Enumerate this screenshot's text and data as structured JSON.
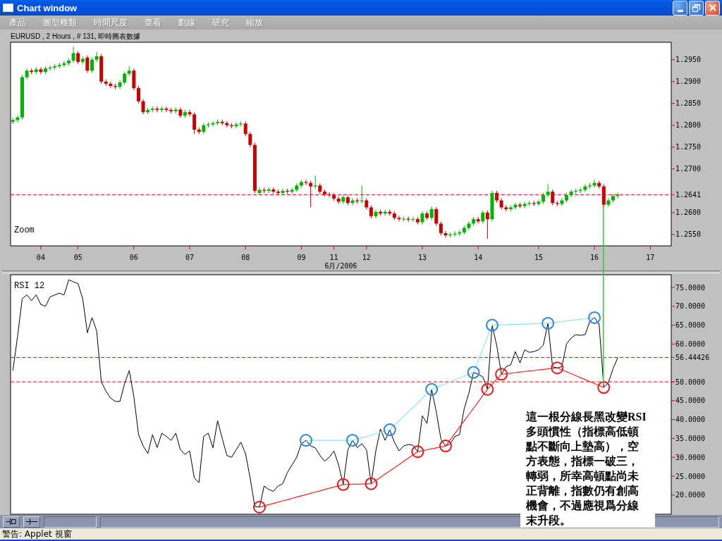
{
  "window": {
    "title": "Chart window"
  },
  "menu": [
    "產品",
    "圖型種類",
    "時間尺度",
    "查看",
    "劃線",
    "研究",
    "縮放"
  ],
  "price_panel": {
    "corner_label": "Zoom",
    "chart_data": {
      "type": "candlestick",
      "title": "EURUSD , 2 Hours , # 131, 即時圖表數據",
      "xlabel": "6月/2006",
      "ylim": [
        1.2524,
        1.299
      ],
      "categories": [
        null,
        null,
        null,
        null,
        null,
        null,
        "04",
        null,
        null,
        null,
        null,
        null,
        null,
        null,
        "05",
        null,
        null,
        null,
        null,
        null,
        null,
        null,
        null,
        null,
        null,
        null,
        "06",
        null,
        null,
        null,
        null,
        null,
        null,
        null,
        null,
        null,
        null,
        null,
        "07",
        null,
        null,
        null,
        null,
        null,
        null,
        null,
        null,
        null,
        null,
        null,
        "08",
        null,
        null,
        null,
        null,
        null,
        null,
        null,
        null,
        null,
        null,
        null,
        "09",
        null,
        null,
        null,
        null,
        null,
        null,
        "11",
        null,
        null,
        null,
        null,
        null,
        null,
        "12",
        null,
        null,
        null,
        null,
        null,
        null,
        null,
        null,
        null,
        null,
        null,
        "13",
        null,
        null,
        null,
        null,
        null,
        null,
        null,
        null,
        null,
        null,
        null,
        "14",
        null,
        null,
        null,
        null,
        null,
        null,
        null,
        null,
        null,
        null,
        null,
        null,
        "15",
        null,
        null,
        null,
        null,
        null,
        null,
        null,
        null,
        null,
        null,
        null,
        "16",
        null,
        null,
        null,
        null,
        null,
        null,
        null,
        null,
        null,
        null,
        null,
        "17",
        null,
        null,
        null,
        null
      ],
      "yticks": [
        {
          "value": 1.255,
          "label": "1.2550"
        },
        {
          "value": 1.26,
          "label": "1.2600"
        },
        {
          "value": 1.27,
          "label": "1.2700"
        },
        {
          "value": 1.275,
          "label": "1.2750"
        },
        {
          "value": 1.28,
          "label": "1.2800"
        },
        {
          "value": 1.285,
          "label": "1.2850"
        },
        {
          "value": 1.29,
          "label": "1.2900"
        },
        {
          "value": 1.295,
          "label": "1.2950"
        }
      ],
      "ref_lines": [
        {
          "axis": "y",
          "value": 1.2641,
          "label": "1.2641"
        }
      ],
      "ohlc": [
        [
          1.2808,
          1.2817,
          1.2803,
          1.2812
        ],
        [
          1.2812,
          1.2823,
          1.2807,
          1.2818
        ],
        [
          1.2818,
          1.2915,
          1.2813,
          1.291
        ],
        [
          1.291,
          1.293,
          1.2905,
          1.2925
        ],
        [
          1.2925,
          1.293,
          1.2917,
          1.2922
        ],
        [
          1.2922,
          1.2933,
          1.2917,
          1.2928
        ],
        [
          1.2928,
          1.2933,
          1.2917,
          1.2922
        ],
        [
          1.2922,
          1.2935,
          1.2917,
          1.293
        ],
        [
          1.293,
          1.2937,
          1.2925,
          1.2932
        ],
        [
          1.2932,
          1.294,
          1.2927,
          1.2935
        ],
        [
          1.2935,
          1.2943,
          1.293,
          1.2938
        ],
        [
          1.2938,
          1.2947,
          1.2933,
          1.2942
        ],
        [
          1.2942,
          1.2953,
          1.2937,
          1.2948
        ],
        [
          1.2948,
          1.298,
          1.2943,
          1.2965
        ],
        [
          1.2965,
          1.297,
          1.294,
          1.2945
        ],
        [
          1.2945,
          1.2957,
          1.294,
          1.2952
        ],
        [
          1.2955,
          1.296,
          1.292,
          1.2925
        ],
        [
          1.2925,
          1.2955,
          1.292,
          1.295
        ],
        [
          1.295,
          1.2968,
          1.2945,
          1.2958
        ],
        [
          1.2958,
          1.2963,
          1.2895,
          1.29
        ],
        [
          1.29,
          1.2905,
          1.289,
          1.2895
        ],
        [
          1.2895,
          1.29,
          1.2885,
          1.289
        ],
        [
          1.289,
          1.2895,
          1.2883,
          1.2888
        ],
        [
          1.2888,
          1.2903,
          1.2883,
          1.2898
        ],
        [
          1.2898,
          1.2923,
          1.2893,
          1.2918
        ],
        [
          1.2918,
          1.2935,
          1.2913,
          1.2925
        ],
        [
          1.2925,
          1.293,
          1.288,
          1.2885
        ],
        [
          1.2885,
          1.289,
          1.285,
          1.2855
        ],
        [
          1.2855,
          1.286,
          1.2825,
          1.283
        ],
        [
          1.283,
          1.284,
          1.2825,
          1.2835
        ],
        [
          1.2835,
          1.2843,
          1.283,
          1.2838
        ],
        [
          1.2838,
          1.2843,
          1.283,
          1.2835
        ],
        [
          1.2835,
          1.2843,
          1.283,
          1.2838
        ],
        [
          1.2838,
          1.2843,
          1.283,
          1.2835
        ],
        [
          1.2835,
          1.284,
          1.2827,
          1.2832
        ],
        [
          1.2832,
          1.2841,
          1.2827,
          1.2836
        ],
        [
          1.2836,
          1.2841,
          1.2817,
          1.2822
        ],
        [
          1.2822,
          1.2835,
          1.2817,
          1.283
        ],
        [
          1.283,
          1.2835,
          1.282,
          1.2825
        ],
        [
          1.2825,
          1.283,
          1.278,
          1.279
        ],
        [
          1.279,
          1.2795,
          1.278,
          1.2785
        ],
        [
          1.2785,
          1.2805,
          1.278,
          1.28
        ],
        [
          1.28,
          1.2807,
          1.2795,
          1.2802
        ],
        [
          1.2802,
          1.281,
          1.2797,
          1.2805
        ],
        [
          1.2805,
          1.2813,
          1.28,
          1.2808
        ],
        [
          1.2808,
          1.2813,
          1.28,
          1.2805
        ],
        [
          1.2805,
          1.281,
          1.2795,
          1.28
        ],
        [
          1.28,
          1.2805,
          1.2793,
          1.2798
        ],
        [
          1.2798,
          1.2807,
          1.2793,
          1.2802
        ],
        [
          1.2802,
          1.2809,
          1.2797,
          1.2804
        ],
        [
          1.2804,
          1.2809,
          1.2775,
          1.278
        ],
        [
          1.278,
          1.2785,
          1.275,
          1.2755
        ],
        [
          1.2755,
          1.276,
          1.2645,
          1.265
        ],
        [
          1.2645,
          1.2657,
          1.264,
          1.2652
        ],
        [
          1.2652,
          1.2657,
          1.2645,
          1.265
        ],
        [
          1.265,
          1.2658,
          1.2645,
          1.2653
        ],
        [
          1.2653,
          1.2658,
          1.2643,
          1.2648
        ],
        [
          1.2648,
          1.2653,
          1.264,
          1.2645
        ],
        [
          1.2645,
          1.2655,
          1.264,
          1.265
        ],
        [
          1.265,
          1.2655,
          1.2643,
          1.2648
        ],
        [
          1.2648,
          1.2657,
          1.2643,
          1.2652
        ],
        [
          1.2652,
          1.2667,
          1.2647,
          1.2662
        ],
        [
          1.2662,
          1.2675,
          1.2657,
          1.267
        ],
        [
          1.267,
          1.2675,
          1.2663,
          1.2668
        ],
        [
          1.2668,
          1.2673,
          1.2612,
          1.266
        ],
        [
          1.266,
          1.2685,
          1.2655,
          1.2662
        ],
        [
          1.2662,
          1.2667,
          1.2643,
          1.2648
        ],
        [
          1.2648,
          1.2653,
          1.2637,
          1.2642
        ],
        [
          1.2642,
          1.2647,
          1.2635,
          1.264
        ],
        [
          1.264,
          1.2645,
          1.2627,
          1.2632
        ],
        [
          1.2632,
          1.2637,
          1.262,
          1.2625
        ],
        [
          1.2625,
          1.264,
          1.262,
          1.2635
        ],
        [
          1.2635,
          1.264,
          1.2617,
          1.2622
        ],
        [
          1.2622,
          1.2633,
          1.2617,
          1.2628
        ],
        [
          1.2628,
          1.2633,
          1.2621,
          1.2626
        ],
        [
          1.2626,
          1.2662,
          1.2621,
          1.2628
        ],
        [
          1.2628,
          1.2633,
          1.2607,
          1.2612
        ],
        [
          1.2612,
          1.2617,
          1.2587,
          1.2592
        ],
        [
          1.2592,
          1.2607,
          1.2587,
          1.2602
        ],
        [
          1.2602,
          1.2607,
          1.2593,
          1.2598
        ],
        [
          1.2598,
          1.2607,
          1.2593,
          1.2602
        ],
        [
          1.2602,
          1.2607,
          1.2593,
          1.2598
        ],
        [
          1.2598,
          1.2603,
          1.2583,
          1.2588
        ],
        [
          1.2588,
          1.2593,
          1.258,
          1.2585
        ],
        [
          1.2585,
          1.2591,
          1.258,
          1.2586
        ],
        [
          1.2586,
          1.2591,
          1.2579,
          1.2584
        ],
        [
          1.2584,
          1.259,
          1.2579,
          1.2585
        ],
        [
          1.2585,
          1.259,
          1.2573,
          1.2578
        ],
        [
          1.2578,
          1.2603,
          1.2573,
          1.2598
        ],
        [
          1.2598,
          1.2603,
          1.2583,
          1.2588
        ],
        [
          1.2588,
          1.2614,
          1.2583,
          1.2608
        ],
        [
          1.2608,
          1.2613,
          1.257,
          1.2575
        ],
        [
          1.2575,
          1.258,
          1.2548,
          1.2553
        ],
        [
          1.2553,
          1.2558,
          1.2543,
          1.2548
        ],
        [
          1.2548,
          1.2555,
          1.2543,
          1.255
        ],
        [
          1.255,
          1.2557,
          1.2545,
          1.2552
        ],
        [
          1.2552,
          1.256,
          1.2547,
          1.2555
        ],
        [
          1.2555,
          1.257,
          1.255,
          1.2565
        ],
        [
          1.2565,
          1.258,
          1.256,
          1.2575
        ],
        [
          1.2575,
          1.259,
          1.257,
          1.2585
        ],
        [
          1.2585,
          1.259,
          1.2575,
          1.258
        ],
        [
          1.258,
          1.2605,
          1.2575,
          1.26
        ],
        [
          1.26,
          1.2605,
          1.254,
          1.2585
        ],
        [
          1.2585,
          1.265,
          1.258,
          1.2645
        ],
        [
          1.2645,
          1.265,
          1.2623,
          1.2628
        ],
        [
          1.2628,
          1.2633,
          1.2607,
          1.2612
        ],
        [
          1.2612,
          1.2617,
          1.2603,
          1.2608
        ],
        [
          1.2608,
          1.2617,
          1.2603,
          1.2612
        ],
        [
          1.2612,
          1.2623,
          1.2607,
          1.2618
        ],
        [
          1.2618,
          1.2623,
          1.261,
          1.2615
        ],
        [
          1.2615,
          1.2625,
          1.261,
          1.262
        ],
        [
          1.262,
          1.2627,
          1.2615,
          1.2622
        ],
        [
          1.2622,
          1.2627,
          1.2615,
          1.262
        ],
        [
          1.262,
          1.263,
          1.2615,
          1.2625
        ],
        [
          1.2625,
          1.2645,
          1.262,
          1.264
        ],
        [
          1.264,
          1.2665,
          1.2635,
          1.2648
        ],
        [
          1.2648,
          1.2653,
          1.2617,
          1.2622
        ],
        [
          1.2622,
          1.2627,
          1.2615,
          1.262
        ],
        [
          1.262,
          1.2633,
          1.2615,
          1.2628
        ],
        [
          1.2628,
          1.2645,
          1.2623,
          1.264
        ],
        [
          1.264,
          1.2653,
          1.2635,
          1.2648
        ],
        [
          1.2648,
          1.2655,
          1.2643,
          1.265
        ],
        [
          1.265,
          1.2657,
          1.2645,
          1.2652
        ],
        [
          1.2652,
          1.2665,
          1.2647,
          1.266
        ],
        [
          1.266,
          1.2667,
          1.2655,
          1.2662
        ],
        [
          1.2662,
          1.2676,
          1.2657,
          1.2668
        ],
        [
          1.2668,
          1.2673,
          1.2655,
          1.266
        ],
        [
          1.266,
          1.2665,
          1.2613,
          1.2618
        ],
        [
          1.2618,
          1.2633,
          1.2613,
          1.2628
        ],
        [
          1.2628,
          1.2643,
          1.2623,
          1.2638
        ],
        [
          1.2638,
          1.2646,
          1.2633,
          1.2641
        ],
        null,
        null,
        null,
        null,
        null,
        null,
        null,
        null,
        null,
        null,
        null
      ]
    }
  },
  "rsi_panel": {
    "chart_data": {
      "type": "line",
      "title": "RSI 12",
      "ylim": [
        14.93,
        78.36
      ],
      "categories": [
        null,
        null,
        null,
        null,
        null,
        null,
        null,
        null,
        null,
        null,
        null,
        null,
        null,
        null,
        null,
        null,
        null,
        null,
        null,
        null,
        null,
        null,
        null,
        null,
        null,
        null,
        null,
        null,
        null,
        null,
        null,
        null,
        null,
        null,
        null,
        null,
        null,
        null,
        null,
        null,
        null,
        null,
        null,
        null,
        null,
        null,
        null,
        null,
        null,
        null,
        null,
        null,
        null,
        null,
        null,
        null,
        null,
        null,
        null,
        null,
        null,
        null,
        null,
        null,
        null,
        null,
        null,
        null,
        null,
        null,
        null,
        null,
        null,
        null,
        null,
        null,
        null,
        null,
        null,
        null,
        null,
        null,
        null,
        null,
        null,
        null,
        null,
        null,
        null,
        null,
        null,
        null,
        null,
        null,
        null,
        null,
        null,
        null,
        null,
        null,
        null,
        null,
        null,
        null,
        null,
        null,
        null,
        null,
        null,
        null,
        null,
        null,
        null,
        null,
        null,
        null,
        null,
        null,
        null,
        null,
        null,
        null,
        null,
        null,
        null,
        null,
        null,
        null,
        null,
        null,
        null,
        null,
        null,
        null,
        null,
        null,
        null,
        null,
        null,
        null,
        null,
        null
      ],
      "yticks": [
        {
          "value": 20,
          "label": "20.0000"
        },
        {
          "value": 25,
          "label": "25.0000"
        },
        {
          "value": 30,
          "label": "30.0000"
        },
        {
          "value": 35,
          "label": "35.0000"
        },
        {
          "value": 40,
          "label": "40.0000"
        },
        {
          "value": 45,
          "label": "45.0000"
        },
        {
          "value": 50,
          "label": "50.0000"
        },
        {
          "value": 60,
          "label": "60.0000"
        },
        {
          "value": 65,
          "label": "65.0000"
        },
        {
          "value": 70,
          "label": "70.0000"
        },
        {
          "value": 75,
          "label": "75.0000"
        }
      ],
      "ref_lines": [
        {
          "axis": "y",
          "value": 56.44426,
          "label": "56.44426"
        },
        {
          "axis": "y",
          "value": 50
        }
      ],
      "series": [
        {
          "color": "#000000",
          "values": [
            53,
            62,
            72,
            73,
            71.5,
            73,
            70.5,
            70,
            72.5,
            73,
            73.5,
            73,
            77,
            76.5,
            76,
            72,
            63,
            67,
            63.5,
            50,
            47.5,
            45.7,
            44.8,
            44.8,
            49.5,
            53,
            46,
            36,
            33,
            31,
            36,
            32.6,
            36.4,
            35.5,
            34.5,
            36.4,
            32,
            30.8,
            31.7,
            24.5,
            23.3,
            35.5,
            36.4,
            32.5,
            39.7,
            35,
            30.5,
            30,
            32,
            34,
            31,
            24.5,
            17,
            16.8,
            22.4,
            21.5,
            21,
            22.4,
            23,
            26,
            28,
            30,
            33.6,
            34.5,
            33,
            32.5,
            30.5,
            29,
            30,
            31.7,
            28,
            22.8,
            32,
            34.5,
            32.6,
            33.6,
            32,
            23,
            31.7,
            37.5,
            34.5,
            37.3,
            34,
            31.7,
            33,
            33.4,
            33.2,
            31.5,
            41,
            39,
            48,
            42,
            34.8,
            33,
            33.6,
            35.5,
            36,
            42.9,
            47,
            52.5,
            52,
            51.3,
            48,
            65,
            59.5,
            52,
            54,
            54.5,
            58,
            55,
            58.5,
            57.8,
            58,
            58.5,
            59.7,
            65.5,
            54,
            53.7,
            54,
            60,
            61.6,
            62.5,
            62.3,
            62.5,
            66,
            67,
            65.3,
            48.5,
            49.8,
            53.5,
            56.4,
            null,
            null,
            null,
            null,
            null,
            null,
            null,
            null,
            null,
            null,
            null
          ]
        },
        {
          "color": "#8ee4f4",
          "values": [
            null,
            null,
            null,
            null,
            null,
            null,
            null,
            null,
            null,
            null,
            null,
            null,
            null,
            null,
            null,
            null,
            null,
            null,
            null,
            null,
            null,
            null,
            null,
            null,
            null,
            null,
            null,
            null,
            null,
            null,
            null,
            null,
            null,
            null,
            null,
            null,
            null,
            null,
            null,
            null,
            null,
            null,
            null,
            null,
            null,
            null,
            null,
            null,
            null,
            null,
            null,
            null,
            null,
            null,
            null,
            null,
            null,
            null,
            null,
            null,
            null,
            null,
            null,
            34.5,
            34.5,
            34.5,
            34.5,
            34.5,
            34.5,
            34.5,
            34.5,
            34.5,
            34.5,
            34.5,
            34.85,
            35.2,
            35.55,
            35.9,
            36.25,
            36.6,
            36.95,
            37.3,
            38.49,
            39.68,
            40.87,
            42.06,
            43.24,
            44.43,
            45.62,
            46.81,
            48,
            48.5,
            49,
            49.5,
            50,
            50.5,
            51,
            51.5,
            52,
            52.5,
            55.63,
            58.75,
            61.88,
            65,
            65.04,
            65.08,
            65.13,
            65.17,
            65.21,
            65.25,
            65.29,
            65.33,
            65.38,
            65.42,
            65.46,
            65.5,
            65.65,
            65.8,
            65.95,
            66.1,
            66.25,
            66.4,
            66.55,
            66.7,
            66.85,
            67,
            null,
            null,
            null,
            null,
            null,
            null,
            null,
            null,
            null,
            null,
            null,
            null,
            null,
            null,
            null,
            null
          ]
        },
        {
          "color": "#ff2020",
          "values": [
            null,
            null,
            null,
            null,
            null,
            null,
            null,
            null,
            null,
            null,
            null,
            null,
            null,
            null,
            null,
            null,
            null,
            null,
            null,
            null,
            null,
            null,
            null,
            null,
            null,
            null,
            null,
            null,
            null,
            null,
            null,
            null,
            null,
            null,
            null,
            null,
            null,
            null,
            null,
            null,
            null,
            null,
            null,
            null,
            null,
            null,
            null,
            null,
            null,
            null,
            null,
            null,
            null,
            16.8,
            17.13,
            17.47,
            17.8,
            18.13,
            18.47,
            18.8,
            19.13,
            19.47,
            19.8,
            20.13,
            20.47,
            20.8,
            21.13,
            21.47,
            21.8,
            22.13,
            22.47,
            22.8,
            22.83,
            22.87,
            22.9,
            22.93,
            22.97,
            23,
            23.85,
            24.7,
            25.55,
            26.4,
            27.25,
            28.1,
            28.95,
            29.8,
            30.65,
            31.5,
            31.75,
            32,
            32.25,
            32.5,
            32.75,
            33,
            34.67,
            36.33,
            38,
            39.67,
            41.33,
            43,
            44.67,
            46.33,
            48,
            49.33,
            50.67,
            52,
            52.14,
            52.28,
            52.43,
            52.57,
            52.71,
            52.85,
            52.99,
            53.13,
            53.28,
            53.42,
            53.56,
            53.7,
            53.18,
            52.66,
            52.14,
            51.62,
            51.1,
            50.58,
            50.06,
            49.54,
            49.02,
            48.5,
            null,
            null,
            null,
            null,
            null,
            null,
            null,
            null,
            null,
            null,
            null,
            null,
            null,
            null
          ]
        }
      ]
    }
  },
  "note": {
    "text": "這一根分線長黑改變RSI多頭慣性（指標高低頓點不斷向上墊高），空方表態，指標一破三，轉弱，所幸高頓點尚未正背離，指數仍有創高機會，不過應視爲分線末升段。"
  },
  "status_bar": {
    "text": "警告: Applet 視窗"
  }
}
